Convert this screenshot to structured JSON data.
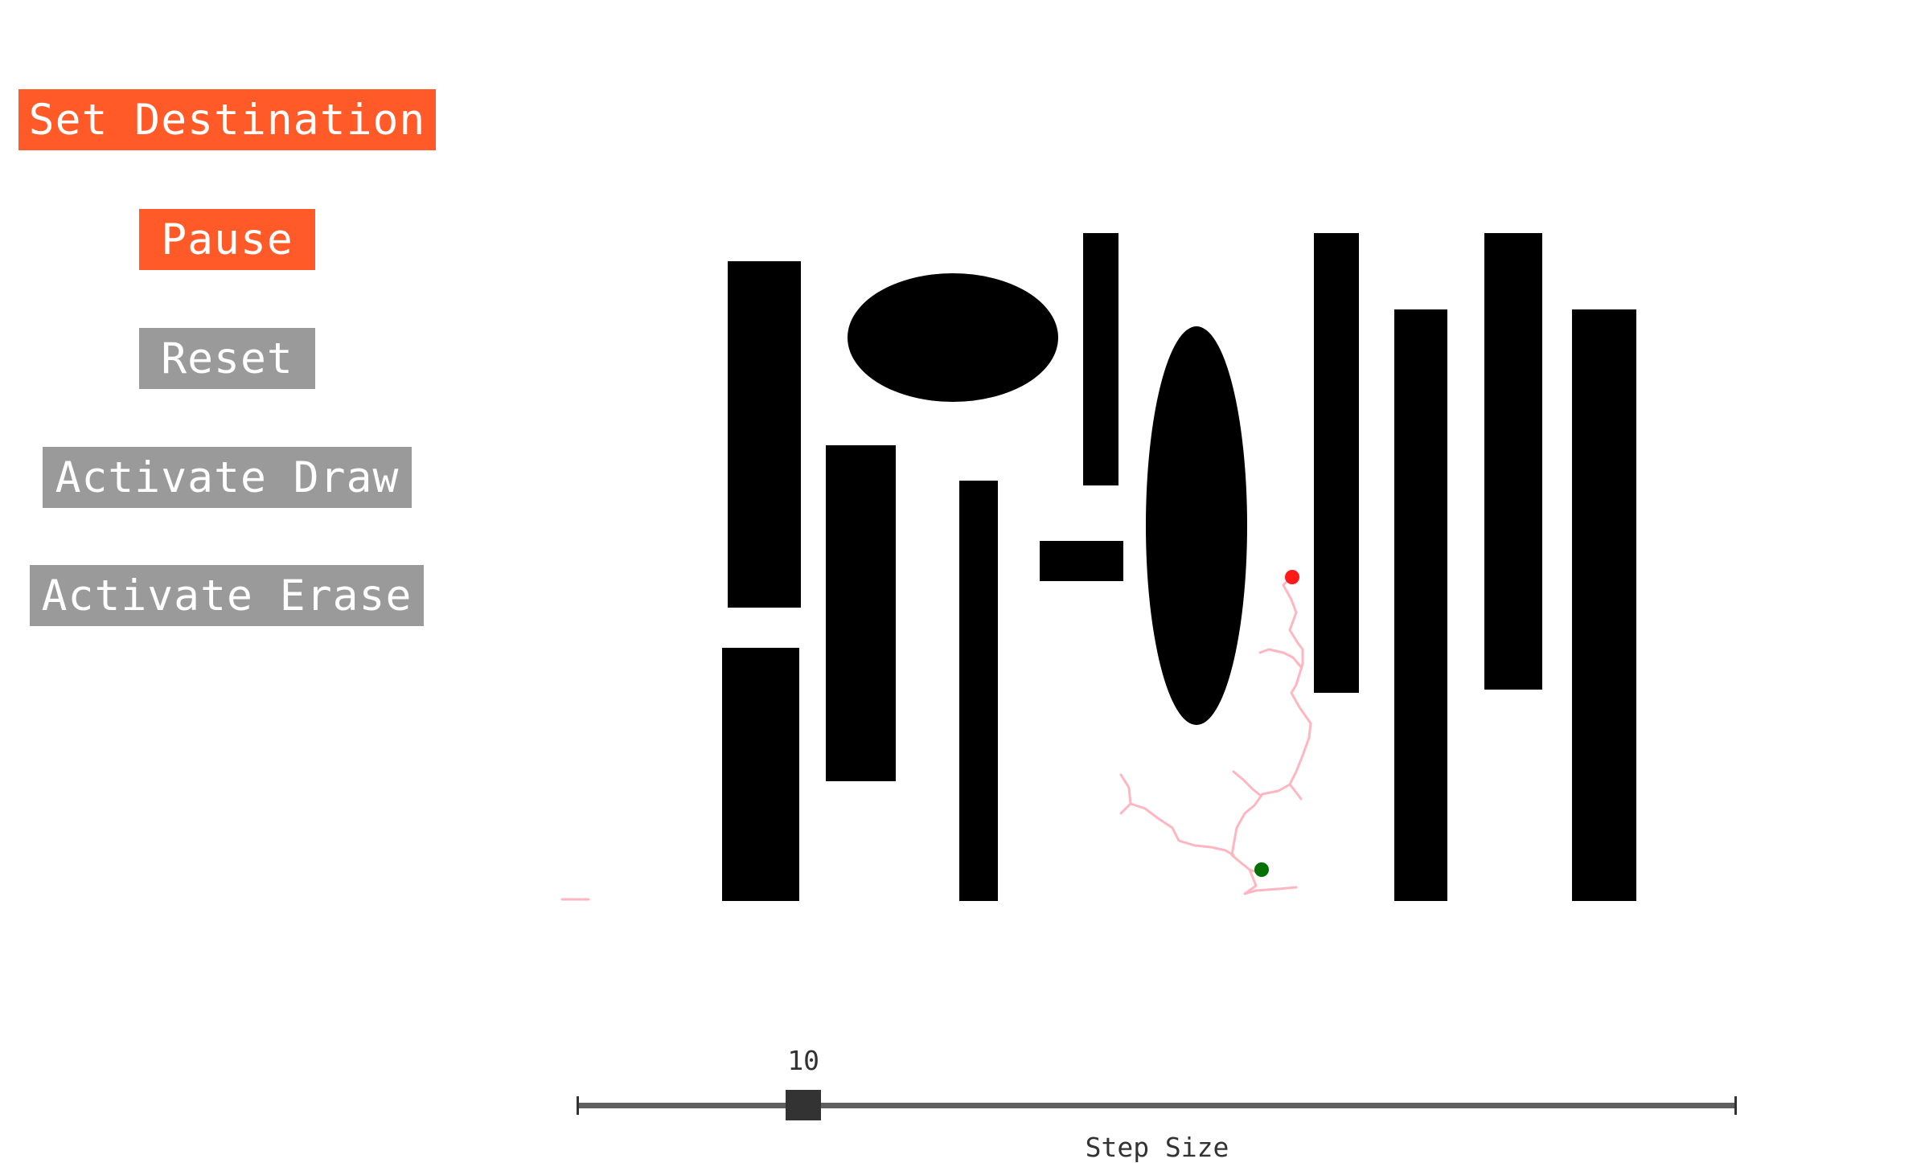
{
  "controls": {
    "set_destination": {
      "label": "Set Destination",
      "color": "#ff5a27"
    },
    "pause": {
      "label": "Pause",
      "color": "#ff5a27"
    },
    "reset": {
      "label": "Reset",
      "color": "#9a9a9a"
    },
    "activate_draw": {
      "label": "Activate Draw",
      "color": "#9a9a9a"
    },
    "activate_erase": {
      "label": "Activate Erase",
      "color": "#9a9a9a"
    }
  },
  "map": {
    "obstacle_color": "#000000",
    "path_color": "#ffb6c1",
    "start_marker_color": "#007000",
    "destination_marker_color": "#ff1a1a"
  },
  "slider": {
    "value": "10",
    "label": "Step Size",
    "fraction": 0.195
  }
}
